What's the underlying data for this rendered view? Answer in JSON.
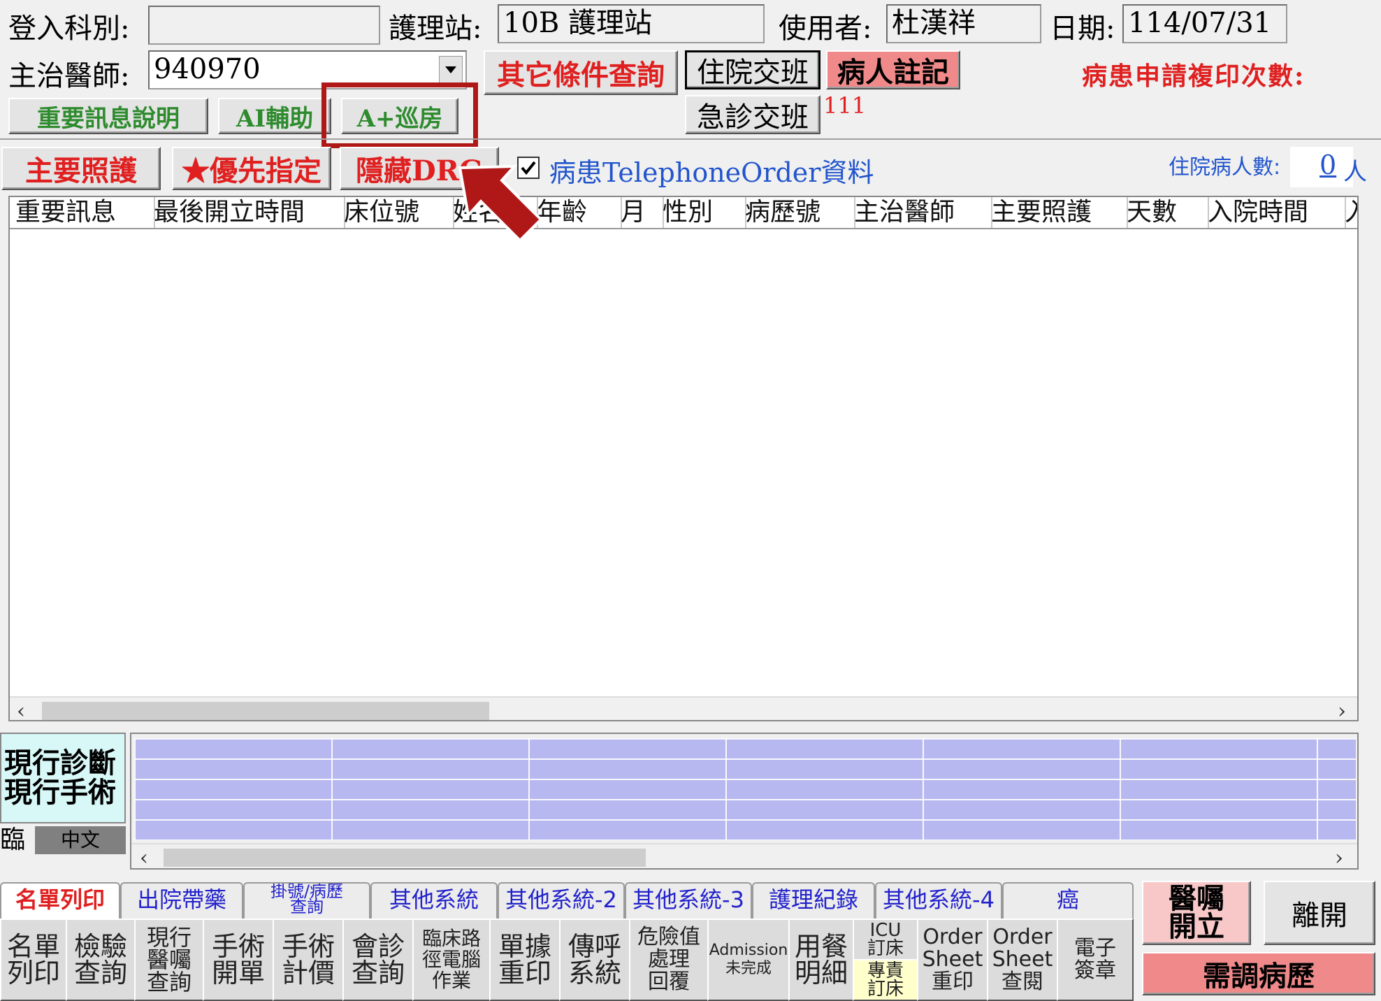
{
  "header": {
    "dept_label": "登入科別:",
    "dept_value": "",
    "station_label": "護理站:",
    "station_value": "10B  護理站",
    "user_label": "使用者:",
    "user_value": "杜漢祥",
    "date_label": "日期:",
    "date_value": "114/07/31",
    "doctor_label": "主治醫師:",
    "doctor_value": "940970",
    "print_request_label": "病患申請複印次數:",
    "count_red": "111"
  },
  "buttons": {
    "other_query": "其它條件查詢",
    "inpatient_handover": "住院交班",
    "patient_note": "病人註記",
    "er_handover": "急診交班",
    "important_info": "重要訊息說明",
    "ai_assist": "AI輔助",
    "a_plus_rounds": "A+巡房",
    "primary_care": "主要照護",
    "priority_assign": "★優先指定",
    "hide_drg": "隱藏DRG"
  },
  "telephone_order": {
    "checked": true,
    "label": "病患TelephoneOrder資料"
  },
  "inpatient_count": {
    "label": "住院病人數:",
    "value": "0",
    "unit": "人"
  },
  "table": {
    "columns": [
      "重要訊息",
      "最後開立時間",
      "床位號",
      "姓名",
      "年齡",
      "月",
      "性別",
      "病歷號",
      "主治醫師",
      "主要照護",
      "天數",
      "入院時間",
      "入"
    ]
  },
  "diagnosis": {
    "line1": "現行診斷",
    "line2": "現行手術",
    "mode_left": "臨",
    "mode_right": "中文"
  },
  "tabs": [
    {
      "label": "名單列印",
      "active": true
    },
    {
      "label": "出院帶藥"
    },
    {
      "label": "掛號/病歷\n查詢"
    },
    {
      "label": "其他系統"
    },
    {
      "label": "其他系統-2"
    },
    {
      "label": "其他系統-3"
    },
    {
      "label": "護理紀錄"
    },
    {
      "label": "其他系統-4"
    },
    {
      "label": "癌"
    }
  ],
  "function_buttons": [
    {
      "label": "名單\n列印"
    },
    {
      "label": "檢驗\n查詢"
    },
    {
      "label": "現行\n醫囑\n查詢"
    },
    {
      "label": "手術\n開單"
    },
    {
      "label": "手術\n計價"
    },
    {
      "label": "會診\n查詢"
    },
    {
      "label": "臨床路\n徑電腦\n作業"
    },
    {
      "label": "單據\n重印"
    },
    {
      "label": "傳呼\n系統"
    },
    {
      "label": "危險值\n處理\n回覆"
    },
    {
      "label": "Admission\n未完成"
    },
    {
      "label": "用餐\n明細"
    },
    {
      "label": "ICU\n訂床"
    },
    {
      "label": "專責\n訂床"
    },
    {
      "label": "Order\nSheet\n重印"
    },
    {
      "label": "Order\nSheet\n查閱"
    },
    {
      "label": "電子\n簽章"
    }
  ],
  "right_panel": {
    "order_entry": "醫囑\n開立",
    "exit": "離開",
    "chart_request": "需調病歷"
  },
  "colors": {
    "red_text": "#e02020",
    "green_text": "#2e8b2e",
    "blue_text": "#2255cc",
    "highlight_red": "#b01818",
    "lavender": "#b8b8f0",
    "cyan_panel": "#d8f8f8",
    "pink_btn": "#f08a8a"
  }
}
